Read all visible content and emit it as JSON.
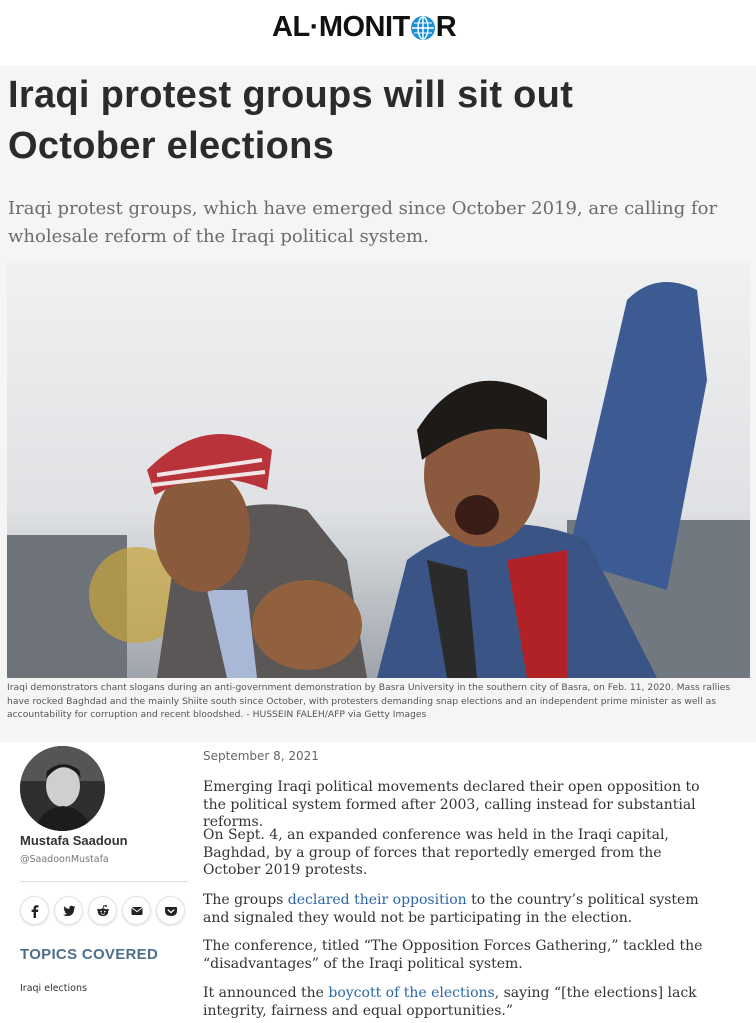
{
  "site": {
    "logo_left": "AL·MONIT",
    "logo_right": "R"
  },
  "article": {
    "headline": "Iraqi protest groups will sit out October elections",
    "dek": "Iraqi protest groups, which have emerged since October 2019, are calling for wholesale reform of the Iraqi political system.",
    "caption": "Iraqi demonstrators chant slogans during an anti-government demonstration by Basra University in the southern city of Basra, on Feb. 11, 2020. Mass rallies have rocked Baghdad and the mainly Shiite south since October, with protesters demanding snap elections and an independent prime minister as well as accountability for corruption and recent bloodshed. - HUSSEIN FALEH/AFP via Getty Images",
    "date": "September 8, 2021",
    "paragraphs": {
      "p1": "Emerging Iraqi political movements declared their open opposition to the political system formed after 2003, calling instead for substantial reforms.",
      "p2": "On Sept. 4, an expanded conference was held in the Iraqi capital, Baghdad, by a group of forces that reportedly emerged from the October 2019 protests.",
      "p3_before": "The groups ",
      "p3_link": "declared their opposition",
      "p3_after": " to the country’s political system and signaled they would not be participating in the election.",
      "p4": "The conference, titled “The Opposition Forces Gathering,” tackled the “disadvantages” of the Iraqi political system.",
      "p5_before": "It announced the ",
      "p5_link": "boycott of the elections",
      "p5_after": ", saying “[the elections] lack integrity, fairness and equal opportunities.”"
    }
  },
  "author": {
    "name": "Mustafa Saadoun",
    "handle": "@SaadoonMustafa"
  },
  "share": {
    "icons": [
      "facebook-icon",
      "twitter-icon",
      "reddit-icon",
      "email-icon",
      "pocket-icon"
    ]
  },
  "topics": {
    "heading": "TOPICS COVERED",
    "items": [
      "Iraqi elections"
    ]
  },
  "colors": {
    "accent": "#4d6f8c",
    "link": "#2a66a5",
    "logo_globe": "#1a8fd6",
    "hero_bg": "#f5f5f5"
  }
}
